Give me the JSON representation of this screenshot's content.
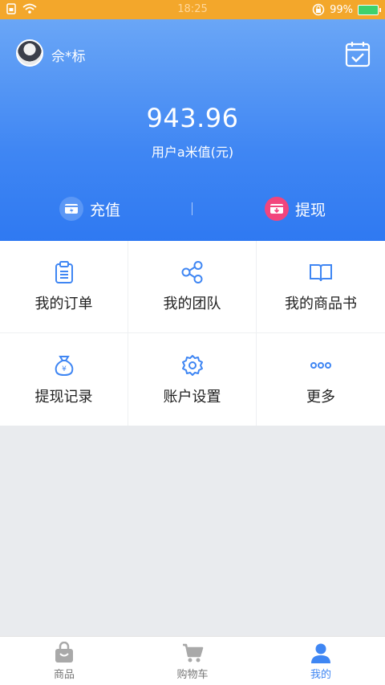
{
  "status_bar": {
    "time": "18:25",
    "battery": "99%"
  },
  "profile": {
    "username": "佘*标"
  },
  "wallet": {
    "balance": "943.96",
    "balance_label": "用户a米值(元)"
  },
  "actions": {
    "recharge": "充值",
    "withdraw": "提现"
  },
  "menu": {
    "items": [
      {
        "label": "我的订单",
        "icon": "clipboard-icon"
      },
      {
        "label": "我的团队",
        "icon": "share-nodes-icon"
      },
      {
        "label": "我的商品书",
        "icon": "book-icon"
      },
      {
        "label": "提现记录",
        "icon": "money-bag-icon"
      },
      {
        "label": "账户设置",
        "icon": "gear-icon"
      },
      {
        "label": "更多",
        "icon": "more-dots-icon"
      }
    ]
  },
  "tabbar": {
    "tabs": [
      {
        "label": "商品",
        "icon": "shopping-bag-icon"
      },
      {
        "label": "购物车",
        "icon": "cart-icon"
      },
      {
        "label": "我的",
        "icon": "user-icon"
      }
    ],
    "active": "我的"
  },
  "colors": {
    "accent": "#3f86f3",
    "statusbar": "#f3a72b",
    "withdraw_badge": "#f2457d"
  }
}
